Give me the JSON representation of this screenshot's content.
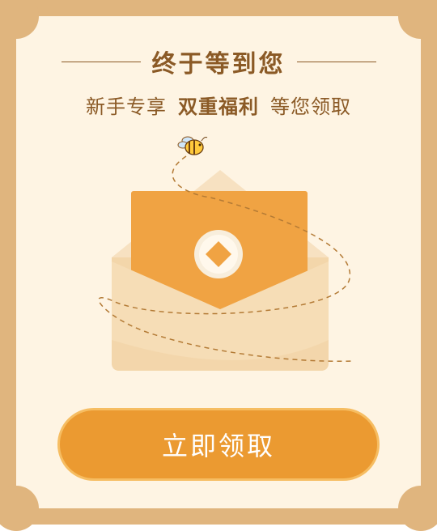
{
  "header": {
    "title": "终于等到您"
  },
  "subtitle": {
    "prefix": "新手专享",
    "highlight": "双重福利",
    "suffix": "等您领取"
  },
  "cta": {
    "label": "立即领取"
  },
  "icons": {
    "mascot": "bee-icon",
    "envelope": "envelope-icon",
    "coin": "coin-icon"
  },
  "colors": {
    "frame": "#E0B57E",
    "background": "#FEF4E3",
    "text": "#8B5A26",
    "button": "#EB9A31",
    "letter": "#F0A343"
  }
}
